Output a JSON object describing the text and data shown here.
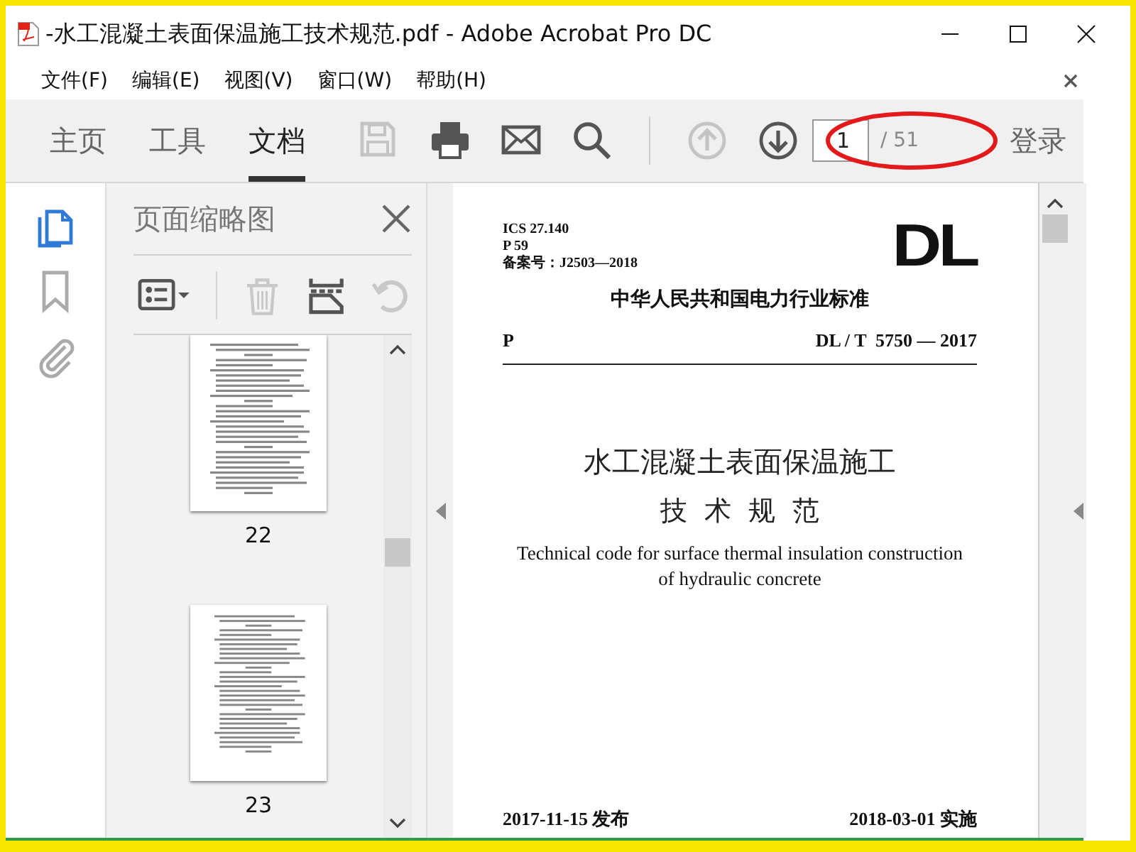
{
  "window": {
    "title": "-水工混凝土表面保温施工技术规范.pdf - Adobe Acrobat Pro DC"
  },
  "menu": [
    {
      "label": "文件(F)"
    },
    {
      "label": "编辑(E)"
    },
    {
      "label": "视图(V)"
    },
    {
      "label": "窗口(W)"
    },
    {
      "label": "帮助(H)"
    }
  ],
  "toolbar": {
    "tabs": [
      {
        "label": "主页",
        "selected": false
      },
      {
        "label": "工具",
        "selected": false
      },
      {
        "label": "文档",
        "selected": true
      }
    ],
    "tools": [
      {
        "kind": "save",
        "disabled": true
      },
      {
        "kind": "print",
        "disabled": false
      },
      {
        "kind": "mail",
        "disabled": false
      },
      {
        "kind": "search",
        "disabled": false
      },
      {
        "kind": "prev",
        "disabled": true
      },
      {
        "kind": "next",
        "disabled": false
      }
    ],
    "page": {
      "value": "1",
      "total": "/ 51",
      "highlighted": true
    },
    "sign_in": "登录"
  },
  "left_rail": [
    {
      "kind": "pages",
      "selected": true
    },
    {
      "kind": "bookmarks",
      "selected": false
    },
    {
      "kind": "attachments",
      "selected": false
    }
  ],
  "thumbnail_panel": {
    "title": "页面缩略图",
    "tools": [
      {
        "kind": "options",
        "disabled": false
      },
      {
        "kind": "delete",
        "disabled": true
      },
      {
        "kind": "insert",
        "disabled": false
      },
      {
        "kind": "undo",
        "disabled": true
      }
    ],
    "pages": [
      {
        "label": "22"
      },
      {
        "label": "23"
      }
    ]
  },
  "document": {
    "header_left": [
      "ICS 27.140",
      "P 59",
      "备案号：J2503—2018"
    ],
    "logo": "DL",
    "authority": "中华人民共和国电力行业标准",
    "category": "P",
    "code": "DL / T  5750 — 2017",
    "title_lines": [
      "水工混凝土表面保温施工",
      "技  术  规  范"
    ],
    "english_title": "Technical code for surface thermal insulation construction of hydraulic concrete",
    "issued": "2017-11-15 发布",
    "effective": "2018-03-01 实施"
  }
}
